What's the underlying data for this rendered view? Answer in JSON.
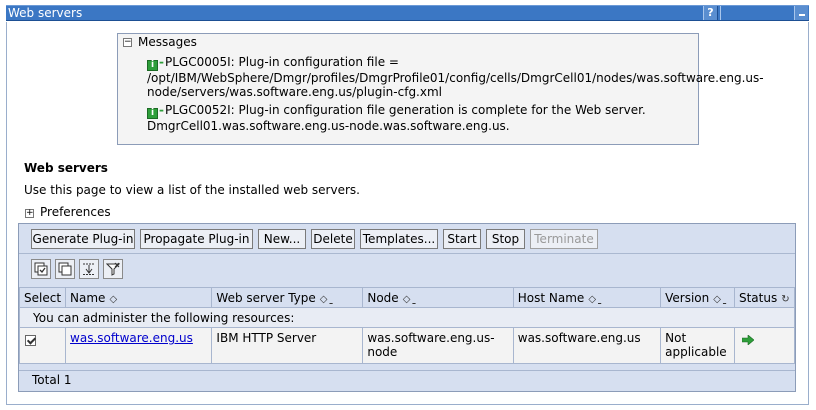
{
  "window": {
    "title": "Web servers",
    "help_label": "?"
  },
  "messages": {
    "heading": "Messages",
    "items": [
      {
        "line1": "PLGC0005I: Plug-in configuration file =",
        "line2": "/opt/IBM/WebSphere/Dmgr/profiles/DmgrProfile01/config/cells/DmgrCell01/nodes/was.software.eng.us-",
        "line3": "node/servers/was.software.eng.us/plugin-cfg.xml"
      },
      {
        "line1": "PLGC0052I: Plug-in configuration file generation is complete for the Web server.",
        "line2": "DmgrCell01.was.software.eng.us-node.was.software.eng.us."
      }
    ]
  },
  "section": {
    "title": "Web servers",
    "description": "Use this page to view a list of the installed web servers.",
    "preferences_label": "Preferences"
  },
  "buttons": {
    "generate": "Generate Plug-in",
    "propagate": "Propagate Plug-in",
    "new": "New...",
    "delete": "Delete",
    "templates": "Templates...",
    "start": "Start",
    "stop": "Stop",
    "terminate": "Terminate"
  },
  "table": {
    "headers": {
      "select": "Select",
      "name": "Name",
      "type": "Web server Type",
      "node": "Node",
      "host": "Host Name",
      "version": "Version",
      "status": "Status"
    },
    "intro": "You can administer the following resources:",
    "rows": [
      {
        "name": "was.software.eng.us",
        "type": "IBM HTTP Server",
        "node_line1": "was.software.eng.us-",
        "node_line2": "node",
        "host": "was.software.eng.us",
        "version_line1": "Not",
        "version_line2": "applicable",
        "selected": true,
        "status_icon": "started-arrow-icon"
      }
    ],
    "total": "Total 1"
  },
  "colors": {
    "titlebar": "#3b77c4",
    "panel": "#d6dff0",
    "link": "#0000cc",
    "status_ok": "#2e9e3a"
  }
}
